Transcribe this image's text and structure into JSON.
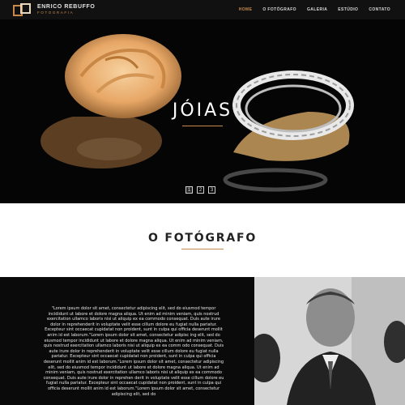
{
  "brand": {
    "name": "ENRICO REBUFFO",
    "tagline": "FOTOGRAFIA",
    "logo_colors": [
      "#c88a4a",
      "#e9d6bf"
    ]
  },
  "nav": {
    "items": [
      {
        "label": "HOME",
        "active": true
      },
      {
        "label": "O FOTÓGRAFO",
        "active": false
      },
      {
        "label": "GALERIA",
        "active": false
      },
      {
        "label": "ESTÚDIO",
        "active": false
      },
      {
        "label": "CONTATO",
        "active": false
      }
    ]
  },
  "hero": {
    "title": "JÓIAS",
    "pager": [
      "1",
      "2",
      "3"
    ],
    "pager_active_index": 0
  },
  "section": {
    "title": "O FOTÓGRAFO"
  },
  "bio": {
    "text": "\"Lorem ipsum dolor sit amet, consectetur adipiscing elit, sed do eiusmod tempor incididunt ut labore et dolore magna aliqua. Ut enim ad minim veniam, quis nostrud exercitation ullamco laboris nisi ut aliquip ex ea commodo consequat. Duis aute irure dolor in reprehenderit in voluptate velit esse cillum dolore eu fugiat nulla pariatur. Excepteur sint occaecat cupidatat non proident, sunt in culpa qui officia deserunt mollit anim id est laborum.\"Lorem ipsum dolor sit amet, consectetur adipisc ing elit, sed do eiusmod tempor incididunt ut labore et dolore magna aliqua. Ut enim ad minim veniam, quis nostrud exercitation ullamco laboris nisi ut aliquip ex ea comm odo consequat. Duis aute irure dolor in reprehenderit in voluptate velit esse cillum dolore eu fugiat nulla pariatur. Excepteur sint occaecat cupidatat non proident, sunt in culpa qui officia deserunt mollit anim id est laborum.\"Lorem ipsum dolor sit amet, consectetur adipiscing elit, sed do eiusmod tempor incididunt ut labore et dolore magna aliqua. Ut enim ad minim veniam, quis nostrud exercitation ullamco laboris nisi ut aliquip ex ea commodo consequat. Duis aute irure dolor in reprehen derit in voluptate velit esse cillum dolore eu fugiat nulla pariatur. Excepteur sint occaecat cupidatat non proident, sunt in culpa qui officia deserunt mollit anim id est laborum.\"Lorem ipsum dolor sit amet, consectetur adipiscing elit, sed do"
  },
  "colors": {
    "accent": "#c88a4a",
    "header_bg": "#111111",
    "dark_bg": "#0a0a0a"
  }
}
